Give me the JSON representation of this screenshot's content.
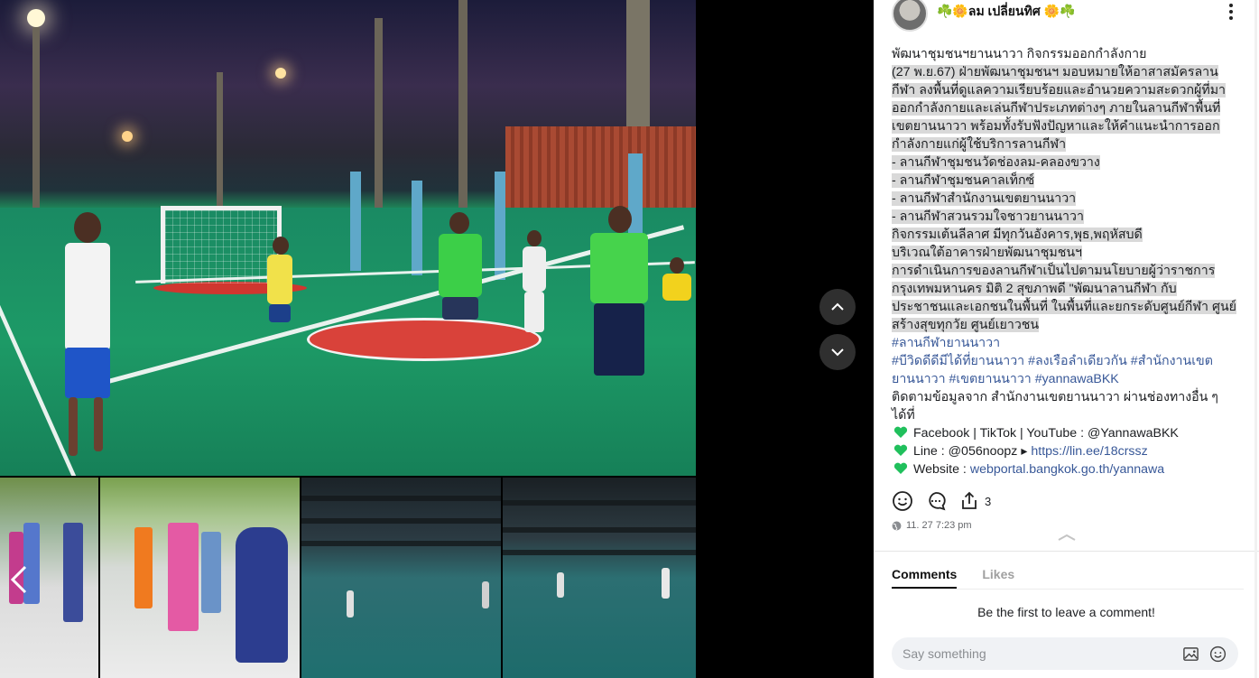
{
  "post": {
    "author": "☘️🌼ลม เปลี่ยนทิศ 🌼☘️",
    "lines": [
      {
        "text": "พัฒนาชุมชนฯยานนาวา กิจกรรมออกกำลังกาย",
        "hl": false
      },
      {
        "text": " (27 พ.ย.67)  ฝ่ายพัฒนาชุมชนฯ มอบหมายให้อาสาสมัครลาน",
        "hl": true
      },
      {
        "text": "กีฬา ลงพื้นที่ดูแลความเรียบร้อยและอำนวยความสะดวกผู้ที่มา",
        "hl": true
      },
      {
        "text": "ออกกำลังกายและเล่นกีฬาประเภทต่างๆ ภายในลานกีฬาพื้นที่",
        "hl": true
      },
      {
        "text": "เขตยานนาวา พร้อมทั้งรับฟังปัญหาและให้คำแนะนำการออก",
        "hl": true
      },
      {
        "text": "กำลังกายแก่ผู้ใช้บริการลานกีฬา",
        "hl": true
      },
      {
        "text": "- ลานกีฬาชุมชนวัดช่องลม-คลองขวาง",
        "hl": true
      },
      {
        "text": "- ลานกีฬาชุมชนคาลเท็กซ์",
        "hl": true
      },
      {
        "text": "- ลานกีฬาสำนักงานเขตยานนาวา",
        "hl": true
      },
      {
        "text": "- ลานกีฬาสวนรวมใจชาวยานนาวา",
        "hl": true
      },
      {
        "text": "กิจกรรมเต้นลีลาศ มีทุกวันอังคาร,พุธ,พฤหัสบดี",
        "hl": true
      },
      {
        "text": "บริเวณใต้อาคารฝ่ายพัฒนาชุมชนฯ",
        "hl": true
      },
      {
        "text": "   การดำเนินการของลานกีฬาเป็นไปตามนโยบายผู้ว่าราชการ",
        "hl": true
      },
      {
        "text": "กรุงเทพมหานคร  มิติ 2 สุขภาพดี  \"พัฒนาลานกีฬา กับ",
        "hl": true
      },
      {
        "text": "ประชาชนและเอกชนในพื้นที่ ในพื้นที่และยกระดับศูนย์กีฬา ศูนย์",
        "hl": true
      },
      {
        "text": "สร้างสุขทุกวัย ศูนย์เยาวชน",
        "hl": true
      }
    ],
    "hashtags": [
      "#ลานกีฬายานนาวา",
      "#บีวิดดีดีมีได้ที่ยานนาวา #ลงเรือลำเดียวกัน #สำนักงานเขต",
      "ยานนาวา #เขตยานนาวา #yannawaBKK"
    ],
    "follow_lines": [
      "ติดตามข้อมูลจาก สำนักงานเขตยานนาวา ผ่านช่องทางอื่น ๆ",
      "ได้ที่"
    ],
    "contacts": {
      "social": "Facebook | TikTok | YouTube : @YannawaBKK",
      "line_prefix": "Line : @056noopz ▸ ",
      "line_link": "https://lin.ee/18crssz",
      "website_prefix": "Website : ",
      "website_link": "webportal.bangkok.go.th/yannawa"
    },
    "share_count": "3",
    "timestamp": "11. 27 7:23 pm"
  },
  "comments": {
    "tab_comments": "Comments",
    "tab_likes": "Likes",
    "empty": "Be the first to leave a comment!",
    "placeholder": "Say something"
  },
  "colors": {
    "link": "#385898",
    "heart": "#20c05c",
    "highlight": "#d9d9d9"
  },
  "icons": {
    "prev": "chevron-left-icon",
    "up": "chevron-up-icon",
    "down": "chevron-down-icon",
    "more": "more-vertical-icon",
    "emoji": "smiley-icon",
    "comment": "comment-bubble-icon",
    "share": "share-icon",
    "globe": "globe-icon",
    "image": "image-icon",
    "heart": "green-heart-icon"
  }
}
